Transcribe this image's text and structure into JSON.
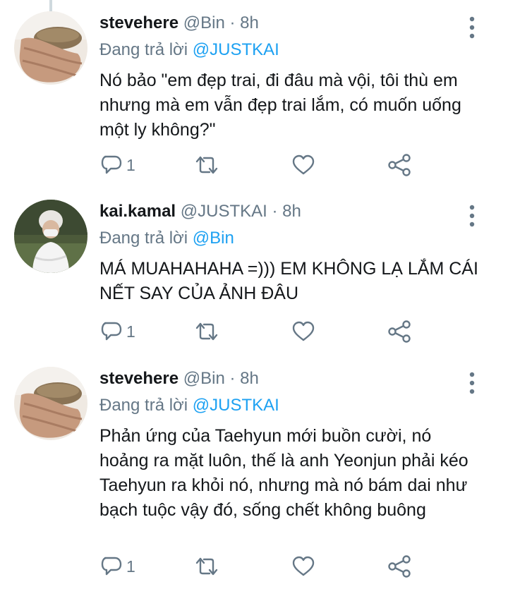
{
  "tweets": [
    {
      "author": "stevehere",
      "handle": "@Bin",
      "separator": "·",
      "time": "8h",
      "replying_prefix": "Đang trả lời",
      "replying_to": "@JUSTKAI",
      "text": "Nó bảo \"em đẹp trai, đi đâu mà vội, tôi thù em nhưng mà em vẫn đẹp trai lắm, có muốn uống một ly không?\"",
      "reply_count": "1",
      "avatar_icon": "avatar-hand-photo"
    },
    {
      "author": "kai.kamal",
      "handle": "@JUSTKAI",
      "separator": "·",
      "time": "8h",
      "replying_prefix": "Đang trả lời",
      "replying_to": "@Bin",
      "text": "MÁ MUAHAHAHA =))) EM KHÔNG LẠ LẮM CÁI NẾT SAY CỦA ẢNH ĐÂU",
      "reply_count": "1",
      "avatar_icon": "avatar-person-photo"
    },
    {
      "author": "stevehere",
      "handle": "@Bin",
      "separator": "·",
      "time": "8h",
      "replying_prefix": "Đang trả lời",
      "replying_to": "@JUSTKAI",
      "text": "Phản ứng của Taehyun mới buồn cười, nó hoảng ra mặt luôn, thế là anh Yeonjun phải kéo Taehyun ra khỏi nó, nhưng mà nó bám dai như bạch tuộc vậy đó, sống chết không buông",
      "reply_count": "1",
      "avatar_icon": "avatar-hand-photo"
    }
  ],
  "colors": {
    "text": "#14171a",
    "secondary": "#657786",
    "mention": "#1da1f2",
    "thread_line": "#cfd9de"
  }
}
